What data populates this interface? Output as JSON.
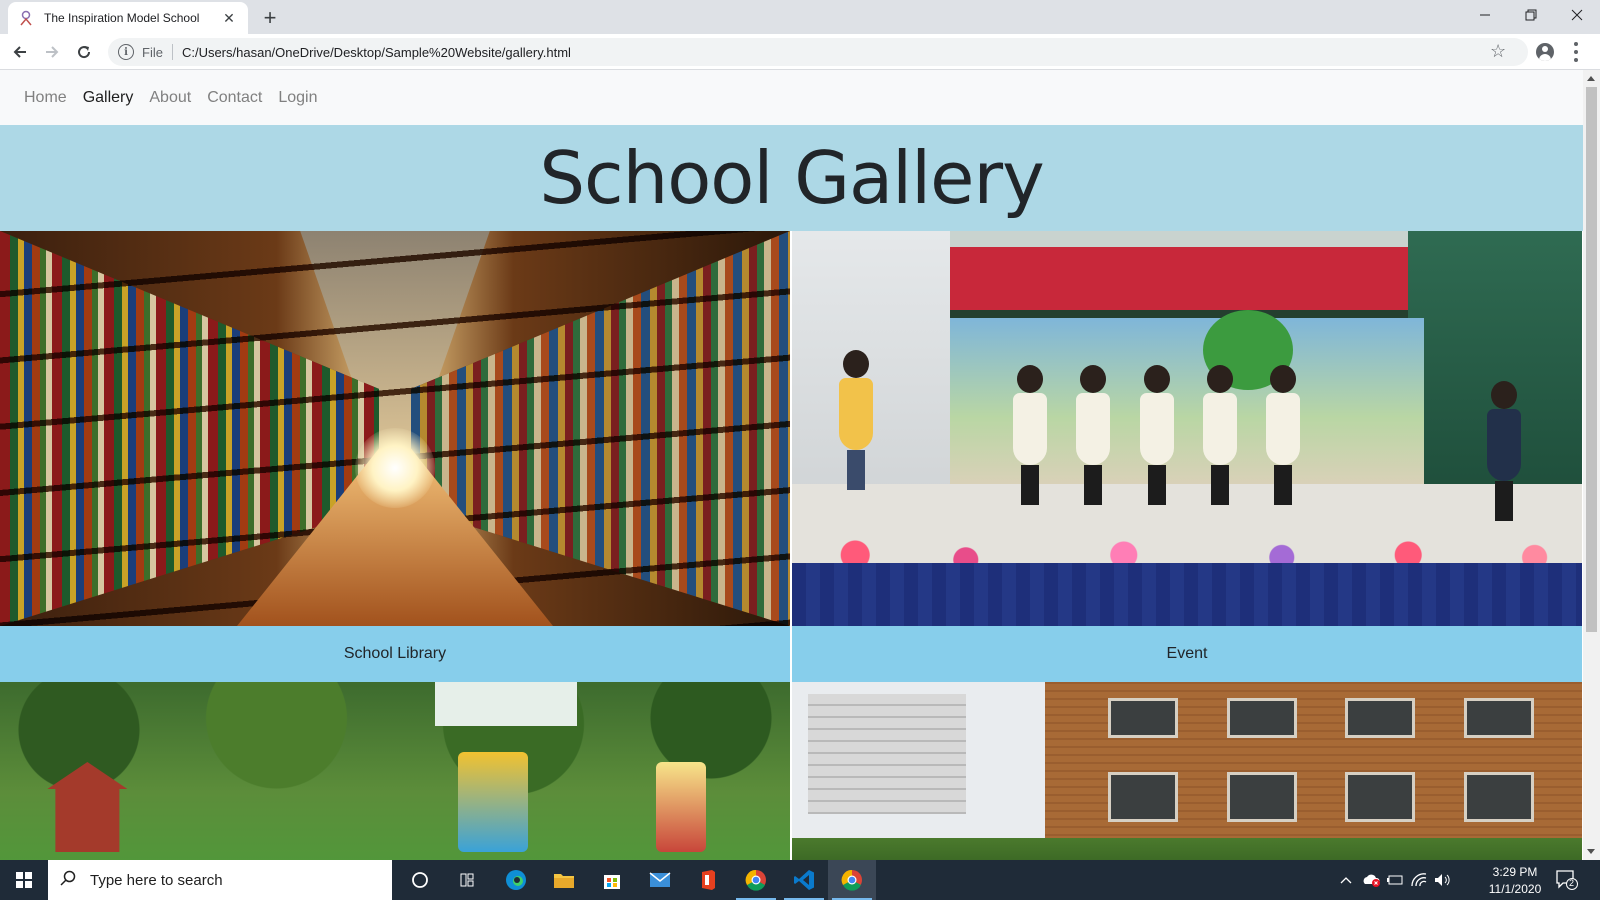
{
  "browser": {
    "tab_title": "The Inspiration Model School",
    "tab_close": "✕",
    "new_tab": "+",
    "omnibox_scheme": "File",
    "url": "C:/Users/hasan/OneDrive/Desktop/Sample%20Website/gallery.html",
    "star": "☆"
  },
  "site": {
    "nav": [
      {
        "label": "Home",
        "active": false
      },
      {
        "label": "Gallery",
        "active": true
      },
      {
        "label": "About",
        "active": false
      },
      {
        "label": "Contact",
        "active": false
      },
      {
        "label": "Login",
        "active": false
      }
    ],
    "hero_title": "School Gallery",
    "gallery": [
      {
        "caption": "School Library",
        "image": "library-bookshelves-image"
      },
      {
        "caption": "Event",
        "image": "children-stage-event-image"
      },
      {
        "caption": "",
        "image": "playground-image"
      },
      {
        "caption": "",
        "image": "school-building-image"
      }
    ]
  },
  "taskbar": {
    "search_placeholder": "Type here to search",
    "time": "3:29 PM",
    "date": "11/1/2020",
    "notification_count": "2",
    "apps": [
      "cortana-icon",
      "task-view-icon",
      "edge-icon",
      "file-explorer-icon",
      "store-icon",
      "mail-icon",
      "office-icon",
      "chrome-icon",
      "vscode-icon",
      "chrome-icon"
    ]
  },
  "colors": {
    "hero_bg": "#add8e6",
    "caption_bg": "#87ceeb",
    "nav_bg": "#f8f9fa",
    "taskbar_bg": "#1f2b38"
  }
}
